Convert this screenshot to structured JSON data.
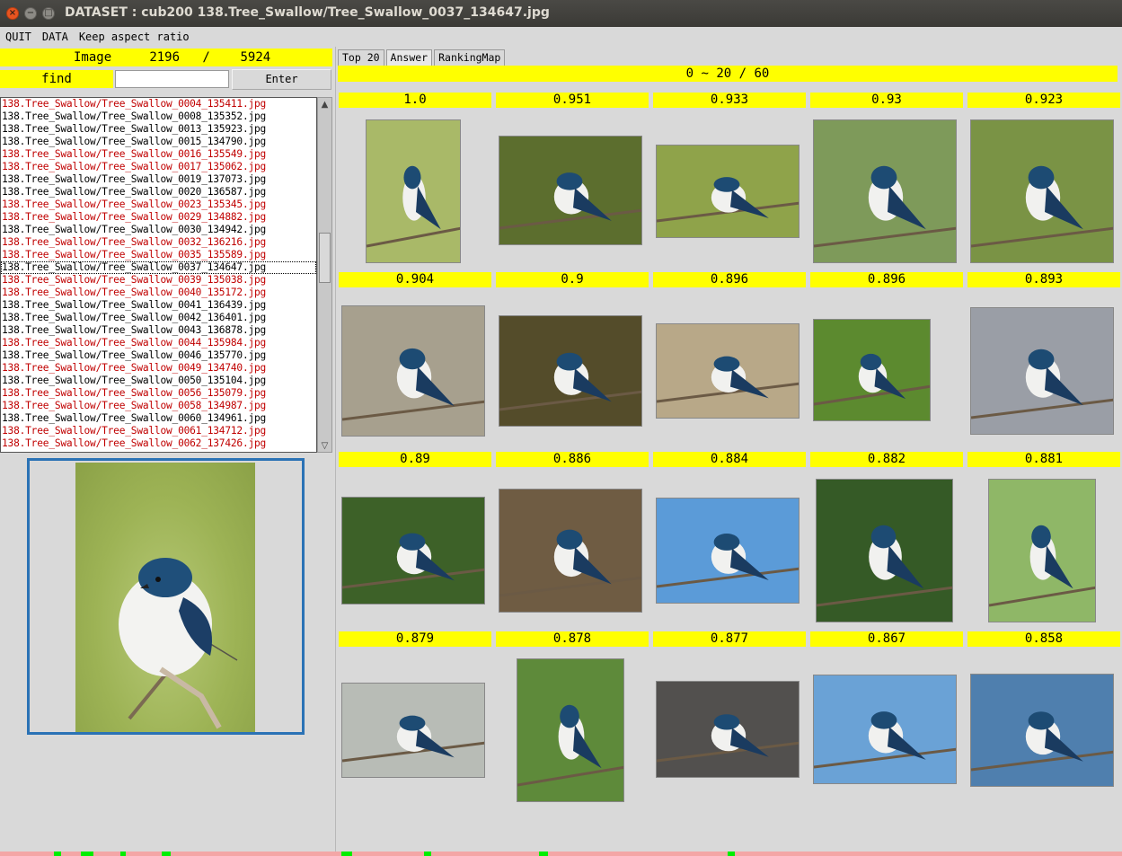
{
  "window": {
    "title": "DATASET : cub200   138.Tree_Swallow/Tree_Swallow_0037_134647.jpg",
    "close_icon": "×",
    "minimize_icon": "−",
    "maximize_icon": "□"
  },
  "menu": {
    "items": [
      "QUIT",
      "DATA",
      "Keep aspect ratio"
    ]
  },
  "left": {
    "image_label": "Image",
    "image_index": "2196",
    "image_sep": "/",
    "image_total": "5924",
    "find_label": "find",
    "find_value": "",
    "enter_label": "Enter",
    "scroll_up_icon": "▲",
    "scroll_down_icon": "▽"
  },
  "file_list": [
    {
      "name": "138.Tree_Swallow/Tree_Swallow_0004_135411.jpg",
      "color": "red"
    },
    {
      "name": "138.Tree_Swallow/Tree_Swallow_0008_135352.jpg",
      "color": "black"
    },
    {
      "name": "138.Tree_Swallow/Tree_Swallow_0013_135923.jpg",
      "color": "black"
    },
    {
      "name": "138.Tree_Swallow/Tree_Swallow_0015_134790.jpg",
      "color": "black"
    },
    {
      "name": "138.Tree_Swallow/Tree_Swallow_0016_135549.jpg",
      "color": "red"
    },
    {
      "name": "138.Tree_Swallow/Tree_Swallow_0017_135062.jpg",
      "color": "red"
    },
    {
      "name": "138.Tree_Swallow/Tree_Swallow_0019_137073.jpg",
      "color": "black"
    },
    {
      "name": "138.Tree_Swallow/Tree_Swallow_0020_136587.jpg",
      "color": "black"
    },
    {
      "name": "138.Tree_Swallow/Tree_Swallow_0023_135345.jpg",
      "color": "red"
    },
    {
      "name": "138.Tree_Swallow/Tree_Swallow_0029_134882.jpg",
      "color": "red"
    },
    {
      "name": "138.Tree_Swallow/Tree_Swallow_0030_134942.jpg",
      "color": "black"
    },
    {
      "name": "138.Tree_Swallow/Tree_Swallow_0032_136216.jpg",
      "color": "red"
    },
    {
      "name": "138.Tree_Swallow/Tree_Swallow_0035_135589.jpg",
      "color": "red"
    },
    {
      "name": "138.Tree_Swallow/Tree_Swallow_0037_134647.jpg",
      "color": "black",
      "selected": true
    },
    {
      "name": "138.Tree_Swallow/Tree_Swallow_0039_135038.jpg",
      "color": "red"
    },
    {
      "name": "138.Tree_Swallow/Tree_Swallow_0040_135172.jpg",
      "color": "red"
    },
    {
      "name": "138.Tree_Swallow/Tree_Swallow_0041_136439.jpg",
      "color": "black"
    },
    {
      "name": "138.Tree_Swallow/Tree_Swallow_0042_136401.jpg",
      "color": "black"
    },
    {
      "name": "138.Tree_Swallow/Tree_Swallow_0043_136878.jpg",
      "color": "black"
    },
    {
      "name": "138.Tree_Swallow/Tree_Swallow_0044_135984.jpg",
      "color": "red"
    },
    {
      "name": "138.Tree_Swallow/Tree_Swallow_0046_135770.jpg",
      "color": "black"
    },
    {
      "name": "138.Tree_Swallow/Tree_Swallow_0049_134740.jpg",
      "color": "red"
    },
    {
      "name": "138.Tree_Swallow/Tree_Swallow_0050_135104.jpg",
      "color": "black"
    },
    {
      "name": "138.Tree_Swallow/Tree_Swallow_0056_135079.jpg",
      "color": "red"
    },
    {
      "name": "138.Tree_Swallow/Tree_Swallow_0058_134987.jpg",
      "color": "red"
    },
    {
      "name": "138.Tree_Swallow/Tree_Swallow_0060_134961.jpg",
      "color": "black"
    },
    {
      "name": "138.Tree_Swallow/Tree_Swallow_0061_134712.jpg",
      "color": "red"
    },
    {
      "name": "138.Tree_Swallow/Tree_Swallow_0062_137426.jpg",
      "color": "red"
    }
  ],
  "tabs": [
    "Top 20",
    "Answer",
    "RankingMap"
  ],
  "active_tab": "Answer",
  "range_label": "0 ~ 20 / 60",
  "results": [
    {
      "score": "1.0",
      "bg": "#a9b968"
    },
    {
      "score": "0.951",
      "bg": "#5c6e2e"
    },
    {
      "score": "0.933",
      "bg": "#8fa34a"
    },
    {
      "score": "0.93",
      "bg": "#7e9a5a"
    },
    {
      "score": "0.923",
      "bg": "#7a9345"
    },
    {
      "score": "0.904",
      "bg": "#a7a08e"
    },
    {
      "score": "0.9",
      "bg": "#544c2a"
    },
    {
      "score": "0.896",
      "bg": "#b8a888"
    },
    {
      "score": "0.896",
      "bg": "#5c8a2f"
    },
    {
      "score": "0.893",
      "bg": "#9a9ea6"
    },
    {
      "score": "0.89",
      "bg": "#3d6128"
    },
    {
      "score": "0.886",
      "bg": "#6f5c43"
    },
    {
      "score": "0.884",
      "bg": "#5b9bd8"
    },
    {
      "score": "0.882",
      "bg": "#355a26"
    },
    {
      "score": "0.881",
      "bg": "#8fb767"
    },
    {
      "score": "0.879",
      "bg": "#b8bcb6"
    },
    {
      "score": "0.878",
      "bg": "#5e8a3a"
    },
    {
      "score": "0.877",
      "bg": "#52504e"
    },
    {
      "score": "0.867",
      "bg": "#6aa2d6"
    },
    {
      "score": "0.858",
      "bg": "#4f7fae"
    }
  ],
  "colors": {
    "highlight": "#ffff00",
    "file_red": "#c00000",
    "preview_border": "#2a72b5",
    "titlebar": "#3b3a36"
  }
}
